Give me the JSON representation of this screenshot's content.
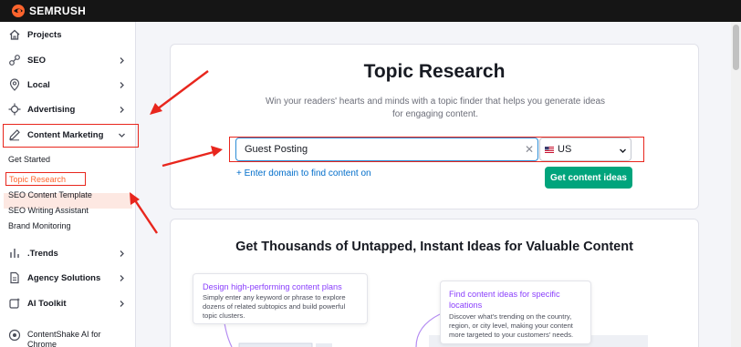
{
  "brand": {
    "name": "SEMRUSH"
  },
  "sidebar": {
    "items": [
      {
        "label": "Projects",
        "icon": "home-icon"
      },
      {
        "label": "SEO",
        "icon": "seo-icon"
      },
      {
        "label": "Local",
        "icon": "location-pin-icon"
      },
      {
        "label": "Advertising",
        "icon": "crosshair-icon"
      },
      {
        "label": "Content Marketing",
        "icon": "pen-icon"
      },
      {
        "label": ".Trends",
        "icon": "bar-chart-icon"
      },
      {
        "label": "Agency Solutions",
        "icon": "document-icon"
      },
      {
        "label": "AI Toolkit",
        "icon": "ai-gear-icon"
      },
      {
        "label": "ContentShake AI for Chrome",
        "icon": "contentshake-icon"
      }
    ],
    "content_marketing_sub": [
      "Get Started",
      "Topic Research",
      "SEO Content Template",
      "SEO Writing Assistant",
      "Brand Monitoring"
    ]
  },
  "main": {
    "title": "Topic Research",
    "description_line1": "Win your readers' hearts and minds with a topic finder that helps you generate ideas",
    "description_line2": "for engaging content.",
    "keyword_value": "Guest Posting",
    "country_value": "US",
    "add_domain_link": "+ Enter domain to find content on",
    "cta_label": "Get content ideas"
  },
  "promo": {
    "title": "Get Thousands of Untapped, Instant Ideas for Valuable Content",
    "card1_title": "Design high-performing content plans",
    "card1_desc": [
      "Simply enter any keyword or phrase to explore",
      "dozens of related subtopics and build powerful",
      "topic clusters."
    ],
    "card2_title": [
      "Find content ideas for specific",
      "locations"
    ],
    "card2_desc": [
      "Discover what's trending on the country,",
      "region, or city level, making your content",
      "more targeted to your customers' needs."
    ]
  },
  "colors": {
    "accent_green": "#00a47c",
    "link_blue": "#006dca",
    "active_orange": "#ff642d",
    "annotation_red": "#e8261d",
    "purple": "#8a3ffc"
  }
}
